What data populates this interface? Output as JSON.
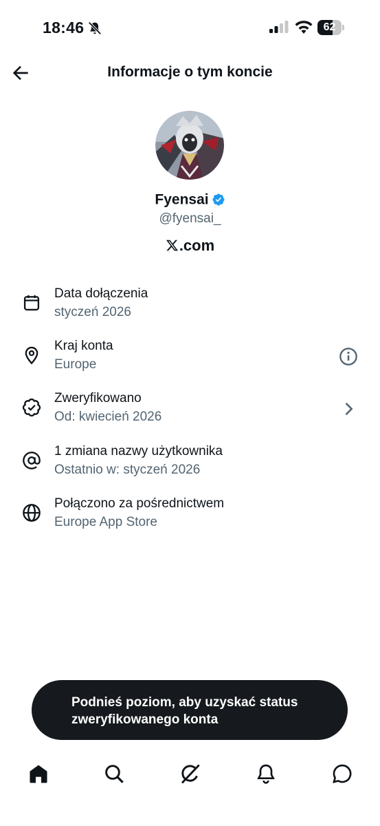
{
  "status_bar": {
    "time": "18:46",
    "battery_text": "62",
    "battery_level": 0.62,
    "icons": [
      "bell-off-icon",
      "signal-icon",
      "wifi-icon",
      "battery-icon"
    ]
  },
  "header": {
    "title": "Informacje o tym koncie",
    "back_icon": "arrow-left-icon"
  },
  "profile": {
    "name": "Fyensai",
    "handle": "@fyensai_",
    "domain": ".com",
    "verified_color": "#1d9bf0"
  },
  "info_items": [
    {
      "icon": "calendar-icon",
      "title": "Data dołączenia",
      "subtitle": "styczeń 2026"
    },
    {
      "icon": "location-pin-icon",
      "title": "Kraj konta",
      "subtitle": "Europe",
      "right_icon": "info-icon"
    },
    {
      "icon": "verified-badge-icon",
      "title": "Zweryfikowano",
      "subtitle": "Od: kwiecień 2026",
      "right_icon": "chevron-right-icon"
    },
    {
      "icon": "at-sign-icon",
      "title": "1 zmiana nazwy użytkownika",
      "subtitle": "Ostatnio w: styczeń 2026"
    },
    {
      "icon": "globe-icon",
      "title": "Połączono za pośrednictwem",
      "subtitle": "Europe App Store"
    }
  ],
  "toast": {
    "text": "Podnieś poziom, aby uzyskać status zweryfikowanego konta"
  },
  "bottom_nav": {
    "items": [
      "home-icon",
      "search-icon",
      "grok-icon",
      "notifications-icon",
      "messages-icon"
    ]
  },
  "colors": {
    "text_primary": "#0f1419",
    "text_secondary": "#536471",
    "toast_bg": "#16191d"
  }
}
